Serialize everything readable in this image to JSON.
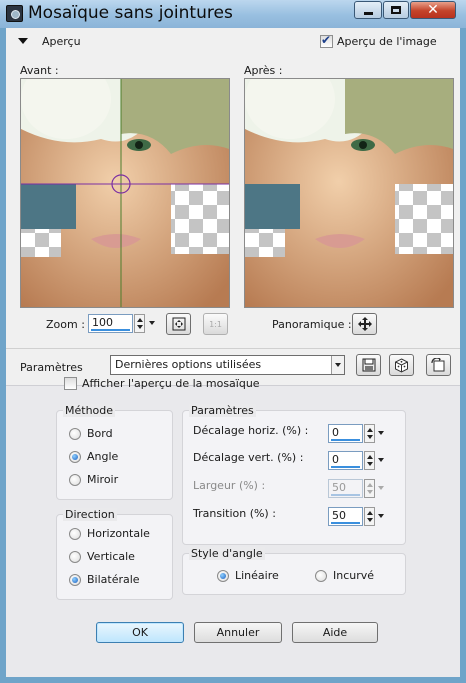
{
  "window": {
    "title": "Mosaïque sans jointures",
    "controls": {
      "minimize_icon": "minimize-icon",
      "maximize_icon": "maximize-icon",
      "close_icon": "close-icon",
      "close_glyph": "✕"
    }
  },
  "preview": {
    "section_label": "Aperçu",
    "image_preview_label": "Aperçu de l'image",
    "image_preview_checked": true,
    "before_label": "Avant :",
    "after_label": "Après :",
    "zoom_label": "Zoom :",
    "zoom_value": "100",
    "one_to_one_label": "1:1",
    "pan_label": "Panoramique :"
  },
  "presets": {
    "label": "Paramètres",
    "selected": "Dernières options utilisées",
    "icons": [
      "save-preset-icon",
      "randomize-icon",
      "reset-icon"
    ]
  },
  "settings": {
    "show_mosaic_label": "Afficher l'aperçu de la mosaïque",
    "show_mosaic_checked": false,
    "method": {
      "title": "Méthode",
      "options": [
        "Bord",
        "Angle",
        "Miroir"
      ],
      "selected": "Angle"
    },
    "direction": {
      "title": "Direction",
      "options": [
        "Horizontale",
        "Verticale",
        "Bilatérale"
      ],
      "selected": "Bilatérale"
    },
    "params": {
      "title": "Paramètres",
      "horiz_offset_label": "Décalage horiz. (%) :",
      "horiz_offset_value": "0",
      "vert_offset_label": "Décalage vert. (%) :",
      "vert_offset_value": "0",
      "width_label": "Largeur (%) :",
      "width_value": "50",
      "transition_label": "Transition (%) :",
      "transition_value": "50"
    },
    "angle_style": {
      "title": "Style d'angle",
      "options": [
        "Linéaire",
        "Incurvé"
      ],
      "selected": "Linéaire"
    }
  },
  "buttons": {
    "ok": "OK",
    "cancel": "Annuler",
    "help": "Aide"
  },
  "colors": {
    "title_bar": "#98bfe0",
    "accent": "#3a8fde",
    "close_red": "#c4432a"
  }
}
